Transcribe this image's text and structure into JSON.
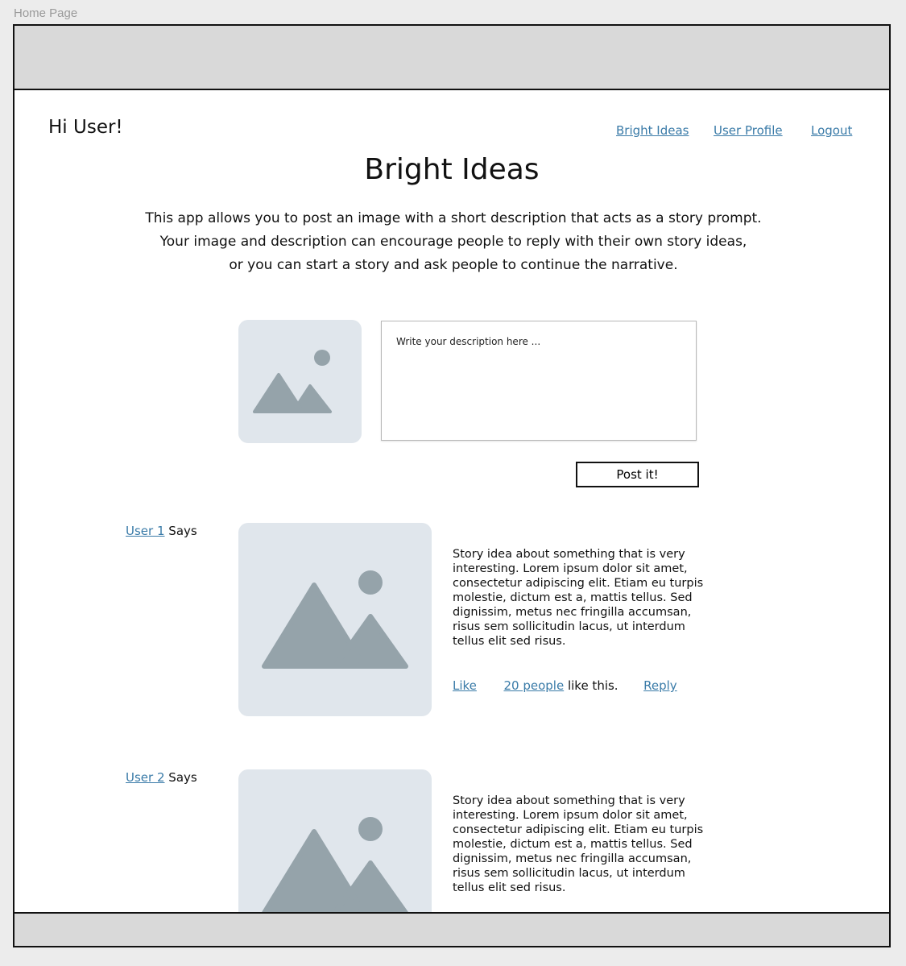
{
  "page_label": "Home Page",
  "header": {
    "greeting": "Hi User!",
    "nav": [
      "Bright Ideas",
      "User Profile",
      "Logout"
    ]
  },
  "main": {
    "title": "Bright Ideas",
    "intro_lines": [
      "This app allows you to post an image with a short description that acts as a story prompt.",
      "Your image and description can encourage people to reply with their own story ideas,",
      "or you can start a story and ask people to continue the narrative."
    ]
  },
  "composer": {
    "placeholder": "Write your description here ...",
    "post_label": "Post it!"
  },
  "posts": [
    {
      "user": "User 1",
      "says": "Says",
      "text": "Story idea about something that is very interesting. Lorem ipsum dolor sit amet, consectetur adipiscing elit. Etiam eu turpis molestie, dictum est a, mattis tellus. Sed dignissim, metus nec fringilla accumsan, risus sem sollicitudin lacus, ut interdum tellus elit sed risus.",
      "like_label": "Like",
      "likes_count": "20 people",
      "likes_suffix": "like this.",
      "reply_label": "Reply"
    },
    {
      "user": "User 2",
      "says": "Says",
      "text": "Story idea about something that is very interesting. Lorem ipsum dolor sit amet, consectetur adipiscing elit. Etiam eu turpis molestie, dictum est a, mattis tellus. Sed dignissim, metus nec fringilla accumsan, risus sem sollicitudin lacus, ut interdum tellus elit sed risus."
    }
  ],
  "colors": {
    "link": "#3a7ba8",
    "placeholder_bg": "#e0e6ec",
    "placeholder_shape": "#95a3aa",
    "bar_bg": "#d9d9d9"
  },
  "icons": {
    "image_placeholder": "image-placeholder-icon"
  }
}
